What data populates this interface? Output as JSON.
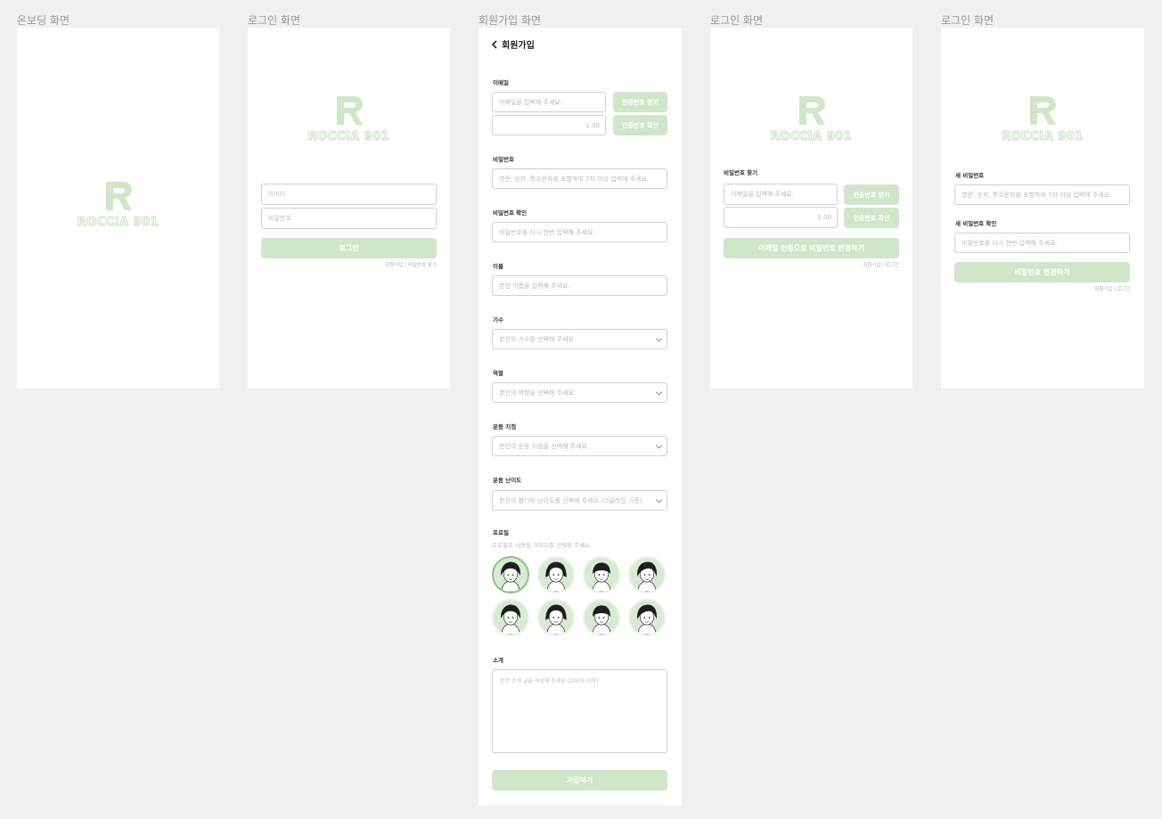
{
  "frames": {
    "onboarding": {
      "title": "온보딩 화면"
    },
    "login": {
      "title": "로그인 화면"
    },
    "signup": {
      "title": "회원가입 화면"
    },
    "find_password": {
      "title": "로그인 화면"
    },
    "reset_password": {
      "title": "로그인 화면"
    }
  },
  "logo": {
    "text": "ROCCIA 901"
  },
  "login": {
    "id_placeholder": "아이디",
    "password_placeholder": "비밀번호",
    "login_button": "로그인",
    "links": "회원가입  |  비밀번호 찾기"
  },
  "signup": {
    "header": "회원가입",
    "email": {
      "label": "이메일",
      "placeholder": "이메일을 입력해 주세요.",
      "send_code_button": "인증번호 받기",
      "timer": "1:00",
      "verify_button": "인증번호 확인"
    },
    "password": {
      "label": "비밀번호",
      "placeholder": "영문, 숫자, 특수문자를 포함하여 7자 이상 입력해 주세요."
    },
    "password_confirm": {
      "label": "비밀번호 확인",
      "placeholder": "비밀번호를 다시 한번 입력해 주세요."
    },
    "name": {
      "label": "이름",
      "placeholder": "본인 이름을 입력해 주세요."
    },
    "generation": {
      "label": "기수",
      "placeholder": "본인의 기수를 선택해 주세요."
    },
    "role": {
      "label": "역할",
      "placeholder": "본인의 역할을 선택해 주세요."
    },
    "branch": {
      "label": "운동 지점",
      "placeholder": "본인의 운동 지점을 선택해 주세요."
    },
    "difficulty": {
      "label": "운동 난이도",
      "placeholder": "본인의 볼더링 난이도를 선택해 주세요.(더클라임 기준)"
    },
    "profile": {
      "label": "프로필",
      "description": "프로필로 사용할 이미지를 선택해 주세요.",
      "selected_index": 0
    },
    "intro": {
      "label": "소개",
      "placeholder": "본인 소개 글을 작성해 주세요.(200자 이하)"
    },
    "submit_button": "가입하기"
  },
  "find_password": {
    "label": "비밀번호 찾기",
    "email_placeholder": "이메일을 입력해 주세요.",
    "send_code_button": "인증번호 받기",
    "timer": "1:00",
    "verify_button": "인증번호 확인",
    "submit_button": "이메일 인증으로 비밀번호 변경하기",
    "links": "회원가입  |  로그인"
  },
  "reset_password": {
    "new_label": "새 비밀번호",
    "new_placeholder": "영문, 숫자, 특수문자를 포함하여 7자 이상 입력해 주세요.",
    "confirm_label": "새 비밀번호 확인",
    "confirm_placeholder": "비밀번호를 다시 한번 입력해 주세요.",
    "submit_button": "비밀번호 변경하기",
    "links": "회원가입  |  로그인"
  },
  "colors": {
    "accent": "#cfe6c9",
    "accent_strong": "#8cc47f",
    "canvas": "#f0f0f0",
    "frame": "#ffffff"
  }
}
